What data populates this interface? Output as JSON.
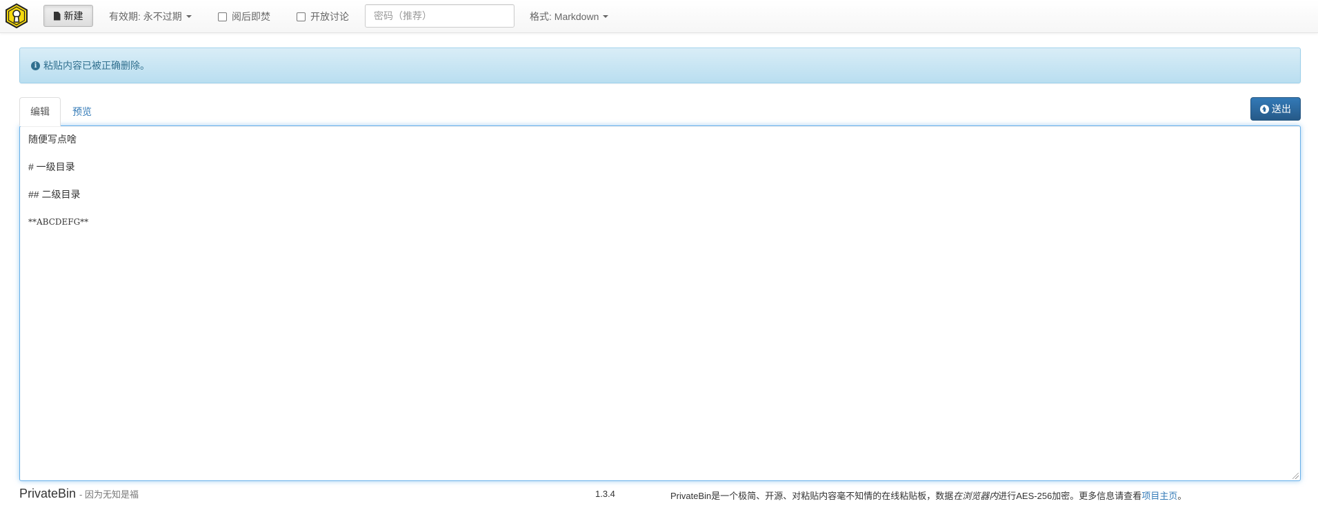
{
  "navbar": {
    "new_button": "新建",
    "expiration": "有效期: 永不过期",
    "burn_after_reading": "阅后即焚",
    "open_discussion": "开放讨论",
    "password_placeholder": "密码（推荐）",
    "format": "格式: Markdown"
  },
  "alert": {
    "message": "粘贴内容已被正确删除。"
  },
  "tabs": {
    "edit": "编辑",
    "preview": "预览"
  },
  "send_button": "送出",
  "editor": {
    "lines": [
      "随便写点啥",
      "# 一级目录",
      "## 二级目录",
      "**ABCDEFG**"
    ]
  },
  "footer": {
    "brand": "PrivateBin",
    "tagline": "- 因为无知是福",
    "version": "1.3.4",
    "description_part1": "PrivateBin是一个极简、开源、对粘贴内容毫不知情的在线粘贴板，数据",
    "description_em": "在浏览器内",
    "description_part2": "进行AES-256加密。更多信息请查看",
    "project_link": "项目主页",
    "description_end": "。"
  },
  "colors": {
    "accent": "#337ab7",
    "alert_bg": "#d9edf7",
    "alert_text": "#31708f",
    "logo_yellow": "#f5d90f"
  }
}
